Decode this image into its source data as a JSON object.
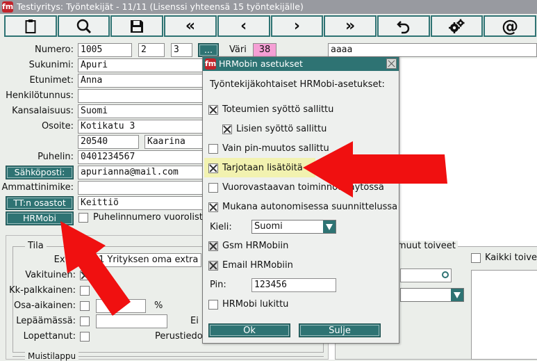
{
  "window": {
    "title": "Testiyritys: Työntekijät - 11/11 (Lisenssi yhteensä 15 työntekijälle)",
    "logo_text": "fm"
  },
  "toolbar": {
    "buttons": [
      {
        "icon": "clipboard-icon"
      },
      {
        "icon": "search-icon"
      },
      {
        "icon": "save-icon"
      },
      {
        "icon": "first-record-icon",
        "label": "«"
      },
      {
        "icon": "previous-record-icon",
        "label": "‹"
      },
      {
        "icon": "next-record-icon",
        "label": "›"
      },
      {
        "icon": "last-record-icon",
        "label": "»"
      },
      {
        "icon": "undo-icon"
      },
      {
        "icon": "settings-gears-icon"
      },
      {
        "icon": "at-icon",
        "label": "@"
      }
    ]
  },
  "form": {
    "numero_label": "Numero:",
    "numero": "1005",
    "numero2": "2",
    "numero3": "3",
    "browse_label": "...",
    "vari_label": "Väri",
    "vari_value": "38",
    "vari_color": "#f59fd5",
    "note_field": "aaaa",
    "sukunimi_label": "Sukunimi:",
    "sukunimi": "Apuri",
    "etunimet_label": "Etunimet:",
    "etunimet": "Anna",
    "henkilotunnus_label": "Henkilötunnus:",
    "henkilotunnus": "",
    "kansalaisuus_label": "Kansalaisuus:",
    "kansalaisuus": "Suomi",
    "osoite_label": "Osoite:",
    "osoite": "Kotikatu 3",
    "postinumero": "20540",
    "postitoimipaikka": "Kaarina",
    "puhelin_label": "Puhelin:",
    "puhelin": "0401234567",
    "sahkoposti_button": "Sähköposti:",
    "sahkoposti": "apurianna@mail.com",
    "ammattinimike_label": "Ammattinimike:",
    "ammattinimike": "",
    "tt_osastot_button": "TT:n osastot",
    "tt_osastot": "Keittiö",
    "hrmobi_button": "HRMobi",
    "puhelinnumero_label": "Puhelinnumero vuorolistalle"
  },
  "tila": {
    "legend": "Tila",
    "extra_label": "Extra",
    "extra_value": "1 Yrityksen oma extra",
    "vakituinen_label": "Vakituinen:",
    "kk_palkkainen_label": "Kk-palkkainen:",
    "osa_aikainen_label": "Osa-aikainen:",
    "percent": "%",
    "lepaamassa_label": "Lepäämässä:",
    "ei_label": "Ei",
    "lopettanut_label": "Lopettanut:",
    "perustiedot_label": "Perustiedot",
    "muistilappu_label": "Muistilappu"
  },
  "right_panel": {
    "muut_toiveet_legend": "muut toiveet",
    "kaikki_toiveet_label": "Kaikki toiveet"
  },
  "dialog": {
    "title": "HRMobin asetukset",
    "heading": "Työntekijäkohtaiset HRMobi-asetukset:",
    "options": [
      {
        "label": "Toteumien syöttö sallittu",
        "checked": true
      },
      {
        "label": "Lisien syöttö sallittu",
        "checked": true
      },
      {
        "label": "Vain pin-muutos sallittu",
        "checked": false
      },
      {
        "label": "Tarjotaan lisätöitä",
        "checked": true,
        "highlight": "#f2f2b0"
      },
      {
        "label": "Vuorovastaavan toiminnot käytössä",
        "checked": false
      },
      {
        "label": "Mukana autonomisessa suunnittelussa",
        "checked": true
      }
    ],
    "kieli_label": "Kieli:",
    "kieli_value": "Suomi",
    "gsm_label": "Gsm HRMobiin",
    "gsm_checked": true,
    "email_label": "Email HRMobiin",
    "email_checked": true,
    "pin_label": "Pin:",
    "pin_value": "123456",
    "lukittu_label": "HRMobi lukittu",
    "lukittu_checked": false,
    "ok_label": "Ok",
    "cancel_label": "Sulje"
  },
  "annotations": {
    "arrow_color": "#f01010"
  }
}
